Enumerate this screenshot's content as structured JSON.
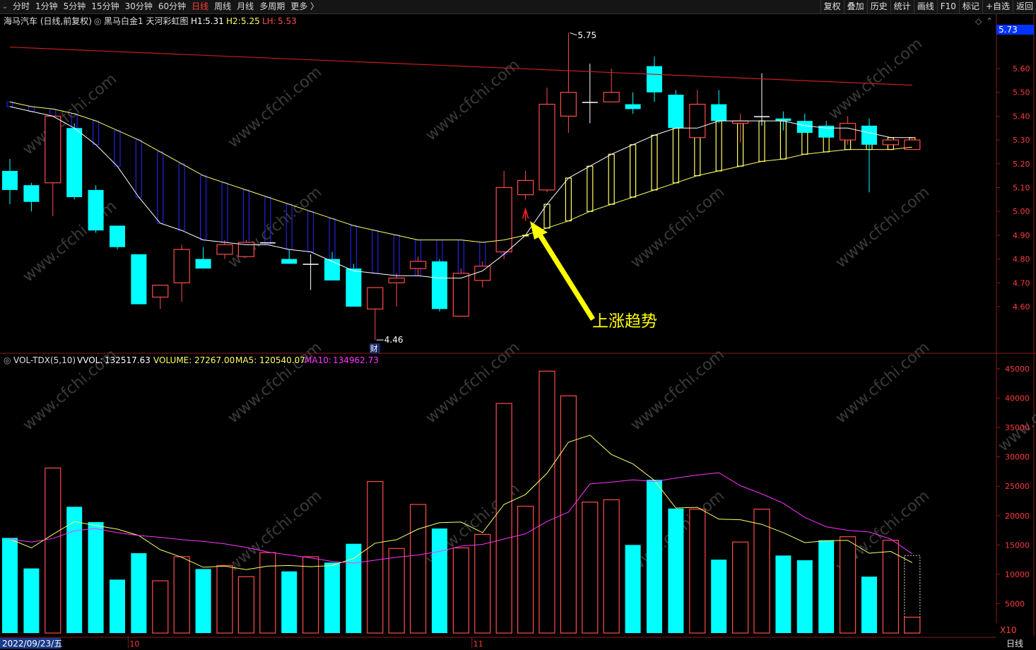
{
  "toolbar": {
    "periods": [
      "分时",
      "1分钟",
      "5分钟",
      "15分钟",
      "30分钟",
      "60分钟",
      "日线",
      "周线",
      "月线",
      "多周期",
      "更多 〉"
    ],
    "active_period": "日线",
    "right_buttons": [
      "复权",
      "叠加",
      "历史",
      "统计",
      "画线",
      "F10",
      "标记",
      "+自选",
      "返回"
    ]
  },
  "price_panel": {
    "title": "海马汽车 (日线,前复权)",
    "indicator_name": "黑马白金1 天河彩虹图",
    "h1_label": "H1:",
    "h1_value": "5.31",
    "h2_label": "H2:",
    "h2_value": "5.25",
    "lh_label": "LH:",
    "lh_value": "5.53",
    "high_label": "5.75",
    "low_label": "4.46",
    "current_price_tag": "5.73",
    "annotation": "上涨趋势",
    "fin_marker": "财"
  },
  "volume_panel": {
    "indicator": "VOL-TDX(5,10)",
    "vvol_label": "VVOL:",
    "vvol_value": "132517.63",
    "volume_label": "VOLUME:",
    "volume_value": "27267.00",
    "ma5_label": "MA5:",
    "ma5_value": "120540.07",
    "ma10_label": "MA10:",
    "ma10_value": "134962.73",
    "unit_label": "X10"
  },
  "date_axis": {
    "start_date": "2022/09/23/五",
    "month_marks": [
      "10",
      "11"
    ],
    "period_label": "日线"
  },
  "watermark": "www.cfchi.com",
  "colors": {
    "up": "#ff4b4b",
    "down": "#00ffff",
    "yellow": "#ffff66",
    "white": "#ffffff",
    "ma_red": "#c81e1e",
    "magenta": "#ff33ff",
    "blue_band": "#2222dd",
    "axis_text": "#ff3b3b"
  },
  "chart_data": [
    {
      "type": "candlestick",
      "title": "海马汽车 (日线,前复权)",
      "y_ticks": [
        4.6,
        4.7,
        4.8,
        4.9,
        5.0,
        5.1,
        5.2,
        5.3,
        5.4,
        5.5,
        5.6
      ],
      "ylim": [
        4.42,
        5.76
      ],
      "ohlc": [
        [
          5.17,
          5.22,
          5.03,
          5.09
        ],
        [
          5.11,
          5.12,
          5.0,
          5.04
        ],
        [
          5.12,
          5.4,
          4.98,
          5.4
        ],
        [
          5.35,
          5.37,
          5.05,
          5.06
        ],
        [
          5.09,
          5.11,
          4.91,
          4.92
        ],
        [
          4.94,
          4.94,
          4.84,
          4.85
        ],
        [
          4.82,
          4.82,
          4.61,
          4.61
        ],
        [
          4.64,
          4.69,
          4.59,
          4.69
        ],
        [
          4.7,
          4.86,
          4.62,
          4.84
        ],
        [
          4.8,
          4.85,
          4.76,
          4.76
        ],
        [
          4.82,
          4.88,
          4.8,
          4.86
        ],
        [
          4.81,
          4.88,
          4.81,
          4.87
        ],
        [
          4.87,
          4.87,
          4.87,
          4.87
        ],
        [
          4.8,
          4.84,
          4.78,
          4.78
        ],
        [
          4.78,
          4.82,
          4.67,
          4.78
        ],
        [
          4.8,
          4.83,
          4.71,
          4.71
        ],
        [
          4.76,
          4.78,
          4.6,
          4.6
        ],
        [
          4.59,
          4.68,
          4.46,
          4.68
        ],
        [
          4.7,
          4.74,
          4.6,
          4.72
        ],
        [
          4.76,
          4.81,
          4.73,
          4.79
        ],
        [
          4.79,
          4.8,
          4.58,
          4.59
        ],
        [
          4.56,
          4.76,
          4.56,
          4.74
        ],
        [
          4.71,
          4.79,
          4.68,
          4.77
        ],
        [
          4.83,
          5.17,
          4.8,
          5.1
        ],
        [
          5.07,
          5.17,
          5.05,
          5.13
        ],
        [
          5.09,
          5.52,
          5.08,
          5.45
        ],
        [
          5.4,
          5.75,
          5.33,
          5.5
        ],
        [
          5.46,
          5.62,
          5.37,
          5.46
        ],
        [
          5.46,
          5.6,
          5.46,
          5.5
        ],
        [
          5.45,
          5.5,
          5.41,
          5.43
        ],
        [
          5.61,
          5.65,
          5.46,
          5.5
        ],
        [
          5.49,
          5.51,
          5.35,
          5.35
        ],
        [
          5.31,
          5.51,
          5.31,
          5.45
        ],
        [
          5.45,
          5.51,
          5.37,
          5.38
        ],
        [
          5.37,
          5.41,
          5.29,
          5.38
        ],
        [
          5.4,
          5.58,
          5.36,
          5.4
        ],
        [
          5.39,
          5.42,
          5.34,
          5.38
        ],
        [
          5.38,
          5.41,
          5.33,
          5.33
        ],
        [
          5.36,
          5.38,
          5.31,
          5.31
        ],
        [
          5.3,
          5.4,
          5.28,
          5.37
        ],
        [
          5.36,
          5.39,
          5.08,
          5.28
        ],
        [
          5.28,
          5.3,
          5.28,
          5.3
        ],
        [
          5.26,
          5.31,
          5.26,
          5.3
        ]
      ],
      "ma_long": {
        "color": "red",
        "start": [
          0,
          5.69
        ],
        "end": [
          42,
          5.53
        ]
      },
      "band_fast": [
        5.44,
        5.42,
        5.4,
        5.35,
        5.28,
        5.19,
        5.06,
        4.95,
        4.92,
        4.88,
        4.87,
        4.86,
        4.86,
        4.84,
        4.83,
        4.79,
        4.75,
        4.74,
        4.73,
        4.73,
        4.72,
        4.72,
        4.75,
        4.82,
        4.9,
        5.03,
        5.14,
        5.19,
        5.24,
        5.28,
        5.32,
        5.35,
        5.35,
        5.38,
        5.38,
        5.38,
        5.38,
        5.36,
        5.35,
        5.35,
        5.33,
        5.31,
        5.31
      ],
      "band_slow": [
        5.46,
        5.44,
        5.43,
        5.41,
        5.38,
        5.34,
        5.3,
        5.25,
        5.2,
        5.15,
        5.12,
        5.09,
        5.06,
        5.03,
        5.0,
        4.97,
        4.94,
        4.92,
        4.9,
        4.88,
        4.88,
        4.88,
        4.87,
        4.88,
        4.9,
        4.93,
        4.96,
        5.0,
        5.03,
        5.06,
        5.09,
        5.12,
        5.15,
        5.17,
        5.19,
        5.21,
        5.22,
        5.24,
        5.25,
        5.26,
        5.26,
        5.26,
        5.27
      ]
    },
    {
      "type": "bar",
      "title": "VOL-TDX(5,10)",
      "y_ticks": [
        5000,
        10000,
        15000,
        20000,
        25000,
        30000,
        35000,
        40000,
        45000
      ],
      "ylim": [
        0,
        46000
      ],
      "volume": [
        16200,
        11000,
        28100,
        21500,
        18900,
        9100,
        13600,
        8900,
        13000,
        10900,
        11500,
        9600,
        13700,
        10500,
        13000,
        12000,
        15200,
        25800,
        14400,
        21900,
        17800,
        14500,
        16800,
        39100,
        21600,
        44600,
        40400,
        22300,
        22700,
        15000,
        26100,
        21200,
        21100,
        12500,
        15500,
        21100,
        13200,
        12400,
        15800,
        16400,
        9600,
        15800,
        13200
      ],
      "ma5": [
        16000,
        14500,
        16800,
        19000,
        18300,
        17700,
        16600,
        14200,
        12900,
        11200,
        11400,
        10800,
        11400,
        11500,
        11300,
        11500,
        12700,
        15300,
        15900,
        17700,
        18800,
        18900,
        17100,
        21900,
        23600,
        27200,
        32500,
        33700,
        30400,
        28800,
        26000,
        21300,
        21400,
        19400,
        19300,
        18500,
        17100,
        15400,
        15700,
        15800,
        13600,
        13900,
        12000
      ],
      "ma10": [
        16000,
        15500,
        16100,
        17400,
        17800,
        17100,
        16600,
        16300,
        15900,
        15600,
        15200,
        14600,
        13800,
        13300,
        12800,
        12200,
        11900,
        12400,
        12900,
        13300,
        13900,
        14800,
        15100,
        16000,
        16900,
        19000,
        20600,
        25400,
        25700,
        26100,
        25800,
        26400,
        26900,
        27300,
        25100,
        23700,
        22100,
        19700,
        18100,
        17500,
        17200,
        16000,
        13500
      ]
    }
  ]
}
